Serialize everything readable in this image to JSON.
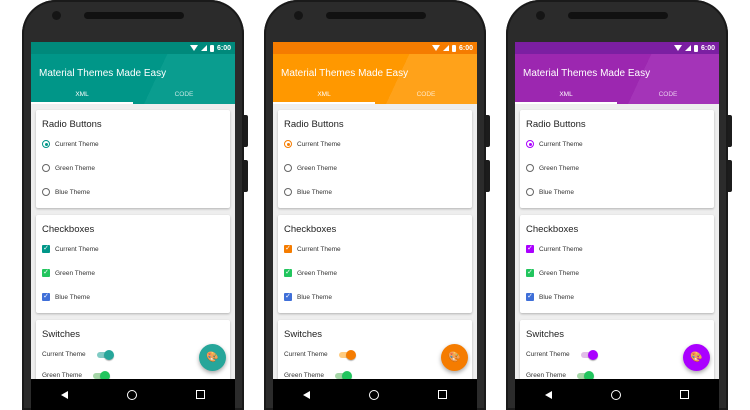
{
  "status": {
    "time": "6:00"
  },
  "app": {
    "title": "Material Themes Made Easy",
    "tabs": [
      "XML",
      "CODE"
    ]
  },
  "sections": {
    "radio_title": "Radio Buttons",
    "radio_items": [
      "Current Theme",
      "Green Theme",
      "Blue Theme"
    ],
    "checkbox_title": "Checkboxes",
    "checkbox_items": [
      "Current Theme",
      "Green Theme",
      "Blue Theme"
    ],
    "switch_title": "Switches",
    "switch_items": [
      "Current Theme",
      "Green Theme"
    ]
  },
  "themes": [
    {
      "name": "teal",
      "primary": "#009688",
      "accent": "#26a69a",
      "switch_track": "#80cbc4"
    },
    {
      "name": "orange",
      "primary": "#ff9800",
      "accent": "#f57c00",
      "switch_track": "#ffcc80"
    },
    {
      "name": "purple",
      "primary": "#9c27b0",
      "accent": "#aa00ff",
      "switch_track": "#e1bee7"
    }
  ],
  "colors": {
    "green": "#22c55e",
    "blue": "#3f6fd8"
  },
  "icons": [
    "palette-icon",
    "wifi-icon",
    "signal-icon",
    "battery-icon",
    "back-icon",
    "home-icon",
    "recents-icon"
  ]
}
